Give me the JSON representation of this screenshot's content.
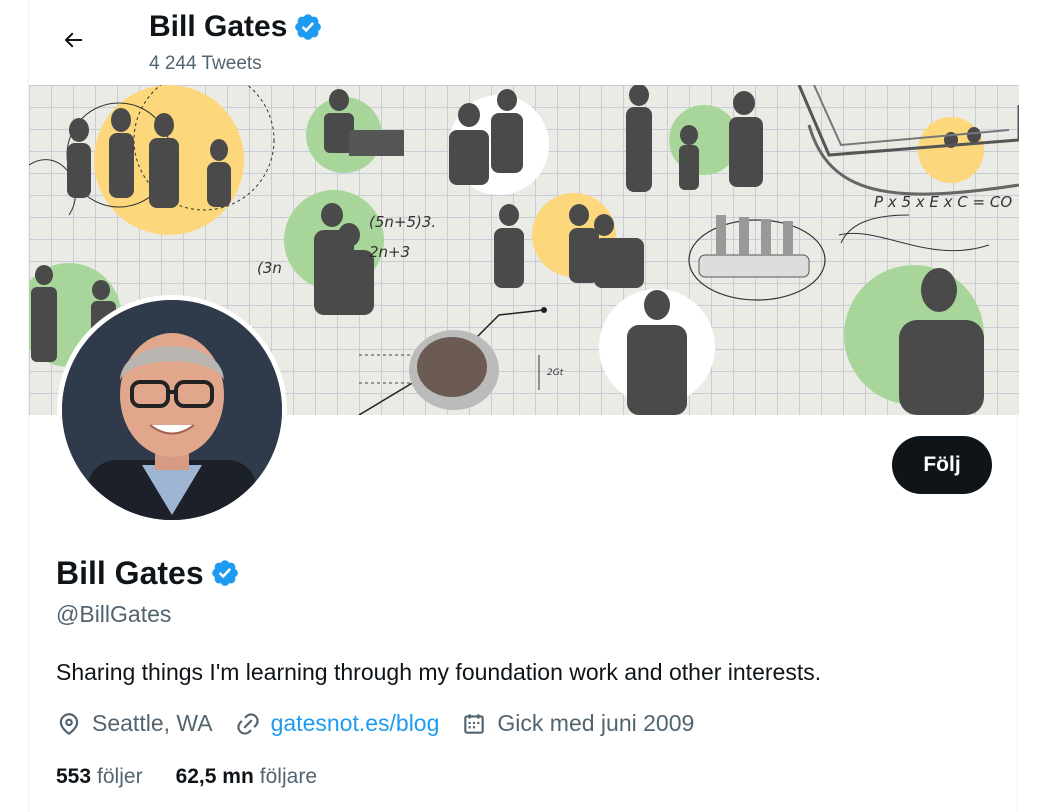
{
  "header": {
    "back_icon": "arrow-left-icon",
    "name": "Bill Gates",
    "tweets_count": "4 244 Tweets"
  },
  "banner": {
    "description_icon": "collage-banner",
    "equations": [
      "(5n+5)3.",
      "2n+3",
      "(3n",
      "P x 5 x E x C = CO",
      "2Gt"
    ]
  },
  "profile": {
    "name": "Bill Gates",
    "verified_icon": "verified-badge-icon",
    "handle": "@BillGates",
    "bio": "Sharing things I'm learning through my foundation work and other interests.",
    "follow_label": "Följ",
    "location": "Seattle, WA",
    "link": "gatesnot.es/blog",
    "joined": "Gick med juni 2009",
    "following_count": "553",
    "following_label": "följer",
    "followers_count": "62,5 mn",
    "followers_label": "följare"
  },
  "colors": {
    "accent": "#1d9bf0",
    "text": "#0f1419",
    "secondary": "#536471",
    "button": "#0f1419"
  }
}
